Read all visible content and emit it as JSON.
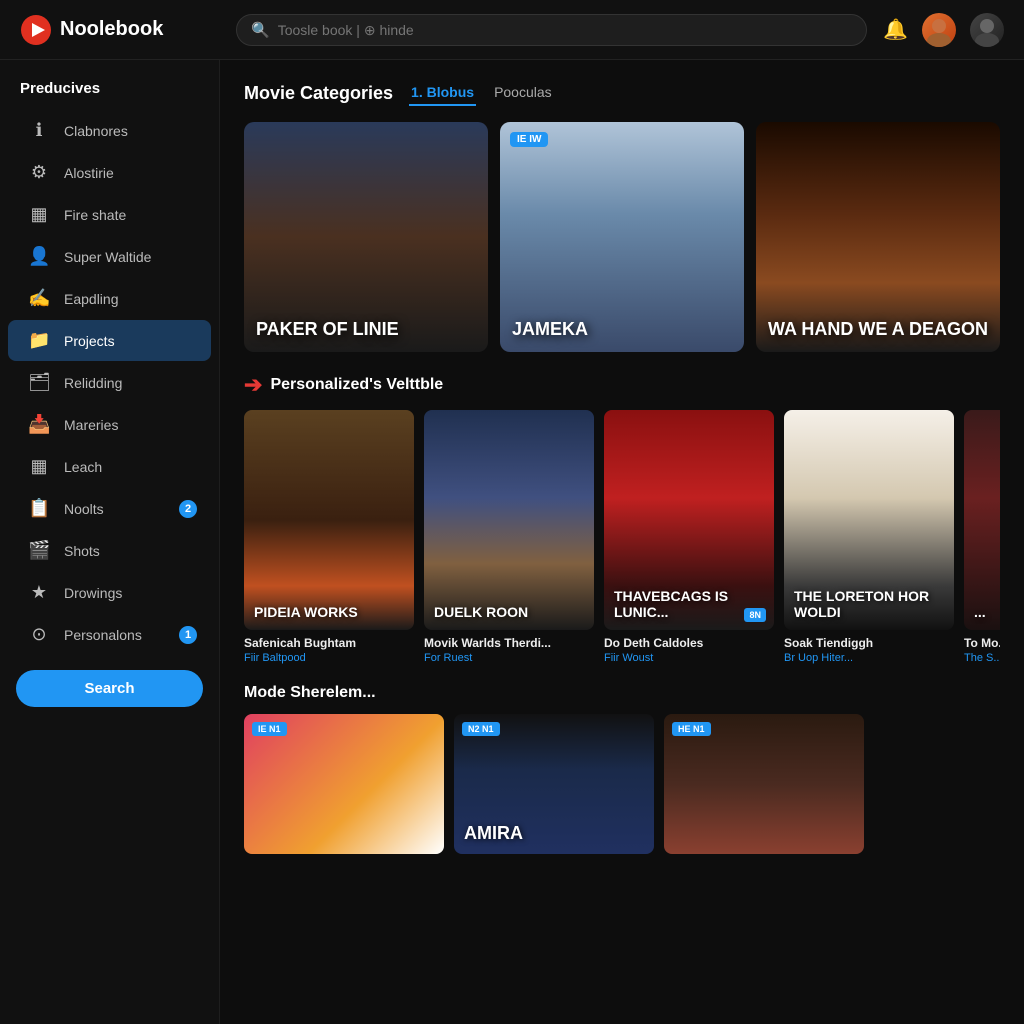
{
  "app": {
    "name": "Noolebook",
    "logo_symbol": "▶"
  },
  "header": {
    "search_placeholder": "Toosle book | ⊕ hinde",
    "bell_label": "🔔"
  },
  "sidebar": {
    "section_title": "Preducives",
    "items": [
      {
        "id": "clabnores",
        "label": "Clabnores",
        "icon": "ℹ",
        "active": false,
        "badge": null
      },
      {
        "id": "alostirie",
        "label": "Alostirie",
        "icon": "⚙",
        "active": false,
        "badge": null
      },
      {
        "id": "fireshate",
        "label": "Fire shate",
        "icon": "▦",
        "active": false,
        "badge": null
      },
      {
        "id": "super-waltide",
        "label": "Super Waltide",
        "icon": "👤",
        "active": false,
        "badge": null
      },
      {
        "id": "eapdling",
        "label": "Eapdling",
        "icon": "✍",
        "active": false,
        "badge": null
      },
      {
        "id": "projects",
        "label": "Projects",
        "icon": "📁",
        "active": true,
        "badge": null
      },
      {
        "id": "relidding",
        "label": "Relidding",
        "icon": "🗂",
        "active": false,
        "badge": null
      },
      {
        "id": "mareries",
        "label": "Mareries",
        "icon": "📥",
        "active": false,
        "badge": null
      },
      {
        "id": "leach",
        "label": "Leach",
        "icon": "▦",
        "active": false,
        "badge": null
      },
      {
        "id": "noolts",
        "label": "Noolts",
        "icon": "📋",
        "active": false,
        "badge": "2"
      },
      {
        "id": "shots",
        "label": "Shots",
        "icon": "🎬",
        "active": false,
        "badge": null
      },
      {
        "id": "drowings",
        "label": "Drowings",
        "icon": "★",
        "active": false,
        "badge": null
      },
      {
        "id": "personalons",
        "label": "Personalons",
        "icon": "⊙",
        "active": false,
        "badge": "1"
      }
    ],
    "search_button": "Search"
  },
  "main": {
    "categories": {
      "title": "Movie Categories",
      "tabs": [
        {
          "id": "blobus",
          "label": "1. Blobus",
          "active": true
        },
        {
          "id": "pooculas",
          "label": "Pooculas",
          "active": false
        }
      ]
    },
    "featured_movies": [
      {
        "id": "paker-of-linie",
        "title": "PAKER of LINIE",
        "badge": null,
        "poster_class": "poster-1"
      },
      {
        "id": "jameka",
        "title": "JAMEKA",
        "badge": "IE IW",
        "poster_class": "poster-2"
      },
      {
        "id": "wa-hand-we-a-deagon",
        "title": "WA HAND WE A DEAGON",
        "badge": null,
        "poster_class": "poster-3"
      }
    ],
    "personalized": {
      "title": "Personalized's Velttble",
      "cards": [
        {
          "id": "safenicah-bughtam",
          "title": "PIDEIA WORKS",
          "name": "Safenicah Bughtam",
          "sub": "Fiir Baltpood",
          "poster_class": "poster-s1",
          "badge": null
        },
        {
          "id": "movik-warlds-therdi",
          "title": "DUELK ROON",
          "name": "Movik Warlds Therdi...",
          "sub": "For Ruest",
          "poster_class": "poster-s2",
          "badge": null
        },
        {
          "id": "do-deth-caldoles",
          "title": "Thavebcags is Lunic...",
          "name": "Do Deth Caldoles",
          "sub": "Fiir Woust",
          "poster_class": "poster-s3",
          "badge": "8N"
        },
        {
          "id": "soak-tiendiggh",
          "title": "THE LORETON HOR WOLDI",
          "name": "Soak Tiendiggh",
          "sub": "Br Uop Hiter...",
          "poster_class": "poster-s4",
          "badge": null
        },
        {
          "id": "to-mo",
          "title": "...",
          "name": "To Mo...",
          "sub": "The S...",
          "poster_class": "poster-s5",
          "badge": null
        }
      ]
    },
    "mode_section": {
      "title": "Mode Sherelem...",
      "cards": [
        {
          "id": "mode-1",
          "title": "",
          "badge": "IE N1",
          "poster_class": "mode-c1"
        },
        {
          "id": "mode-2",
          "title": "AMIRA",
          "badge": "N2 N1",
          "poster_class": "mode-c2"
        },
        {
          "id": "mode-3",
          "title": "",
          "badge": "HE N1",
          "poster_class": "mode-c3"
        }
      ]
    }
  }
}
